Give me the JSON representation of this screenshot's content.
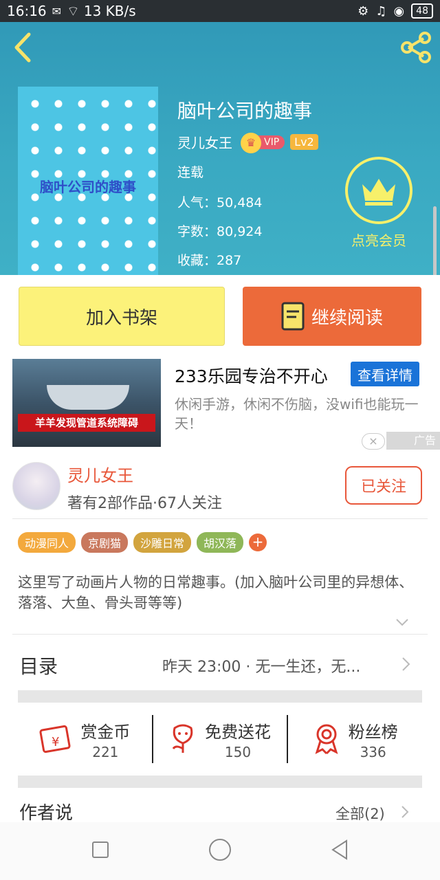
{
  "status": {
    "time": "16:16",
    "speed": "13 KB/s",
    "battery": "48"
  },
  "book": {
    "title": "脑叶公司的趣事",
    "cover_title": "脑叶公司的趣事",
    "author": "灵儿女王",
    "vip": "VIP",
    "level": "Lv2",
    "status": "连载",
    "popularity": "人气：50,484",
    "words": "字数：80,924",
    "favorites": "收藏：287"
  },
  "member": {
    "label": "点亮会员"
  },
  "actions": {
    "add_shelf": "加入书架",
    "continue_read": "继续阅读"
  },
  "ad": {
    "title": "233乐园专治不开心",
    "button": "查看详情",
    "desc": "休闲手游，休闲不伤脑，没wifi也能玩一天！",
    "banner": "羊羊发现管道系统障碍",
    "tag": "广告",
    "close": "×"
  },
  "author_info": {
    "name": "灵儿女王",
    "stats": "著有2部作品·67人关注",
    "follow": "已关注"
  },
  "tags": [
    {
      "label": "动漫同人",
      "color": "#f3a93d"
    },
    {
      "label": "京剧猫",
      "color": "#c9785d"
    },
    {
      "label": "沙雕日常",
      "color": "#d2a43e"
    },
    {
      "label": "胡汉落",
      "color": "#8fb758"
    }
  ],
  "tag_plus": "+",
  "description": "这里写了动画片人物的日常趣事。(加入脑叶公司里的异想体、落落、大鱼、骨头哥等等)",
  "catalog": {
    "title": "目录",
    "latest": "昨天 23:00 · 无一生还，无..."
  },
  "stats": [
    {
      "label": "赏金币",
      "value": "221",
      "icon": "red-envelope-icon"
    },
    {
      "label": "免费送花",
      "value": "150",
      "icon": "flower-icon"
    },
    {
      "label": "粉丝榜",
      "value": "336",
      "icon": "medal-icon"
    }
  ],
  "author_says": {
    "title": "作者说",
    "all": "全部(2)"
  },
  "colors": {
    "accent": "#ec6a3a",
    "header": "#3aa9c2",
    "shelf": "#fcf27a",
    "link": "#e8573a",
    "ad_button": "#1a73d8"
  }
}
